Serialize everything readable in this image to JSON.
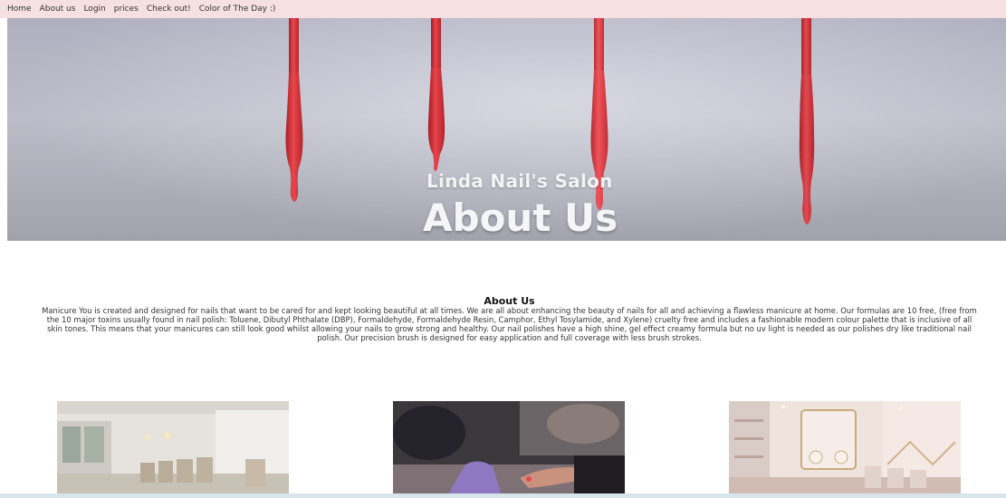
{
  "nav": {
    "items": [
      "Home",
      "About us",
      "Login",
      "prices",
      "Check out!",
      "Color of The Day :)"
    ]
  },
  "hero": {
    "subtitle": "Linda Nail's Salon",
    "title": "About Us"
  },
  "about": {
    "heading": "About Us",
    "body": "Manicure You is created and designed for nails that want to be cared for and kept looking beautiful at all times. We are all about enhancing the beauty of nails for all and achieving a flawless manicure at home. Our formulas are 10 free, (free from the 10 major toxins usually found in nail polish: Toluene, Dibutyl Phthalate (DBP), Formaldehyde, Formaldehyde Resin, Camphor, Ethyl Tosylamide, and Xylene) cruelty free and includes a fashionable modern colour palette that is inclusive of all skin tones. This means that your manicures can still look good whilst allowing your nails to grow strong and healthy. Our nail polishes have a high shine, gel effect creamy formula but no uv light is needed as our polishes dry like traditional nail polish. Our precision brush is designed for easy application and full coverage with less brush strokes."
  },
  "colors": {
    "nav_bg": "#f7e0e0",
    "polish_red": "#e23a3e",
    "hero_bg": "#c3c3cf"
  },
  "icons": [
    "nail-polish-brush-icon"
  ]
}
